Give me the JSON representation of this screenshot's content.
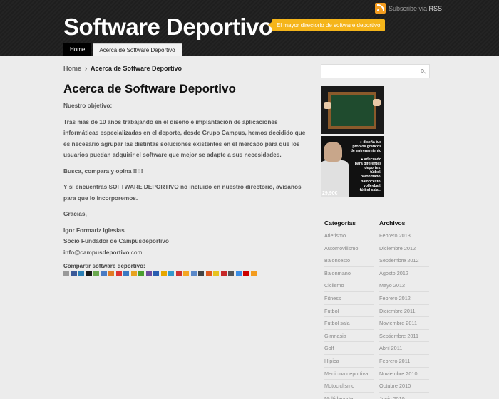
{
  "header": {
    "rss_prefix": "Subscribe via",
    "rss_label": "RSS",
    "site_title": "Software Deportivo",
    "tagline": "El mayor directorio de software deportivo",
    "nav": [
      "Home",
      "Acerca de Software Deportivo"
    ]
  },
  "breadcrumb": {
    "home": "Home",
    "separator": "›",
    "current": "Acerca de Software Deportivo"
  },
  "page": {
    "title": "Acerca de Software Deportivo",
    "objective": "Nuestro objetivo:",
    "p1": "Tras mas de 10 años trabajando en el diseño e implantación de aplicaciones informáticas especializadas en el deporte, desde  Grupo Campus, hemos decidido que es necesario agrupar las distintas soluciones existentes en el mercado para que los usuarios puedan adquirir el software que mejor se adapte a sus necesidades.",
    "p2": "Busca, compara y opina !!!!!",
    "p3": "Y si encuentras SOFTWARE DEPORTIVO no incluido en nuestro directorio, avísanos para que lo incorporemos.",
    "p4": "Gracias,",
    "sig1": "Igor Formariz Iglesias",
    "sig2": "Socio Fundador de Campusdeportivo",
    "email_bold": "info@campusdeportivo",
    "email_plain": ".com"
  },
  "share": {
    "label": "Compartir software deportivo:",
    "icon_colors": [
      "#999",
      "#3b5998",
      "#2a7fb5",
      "#1a1a1a",
      "#6aa84f",
      "#4a7bc4",
      "#e07b24",
      "#d33",
      "#3a78c2",
      "#e8a21f",
      "#4b9e2f",
      "#6d4c9e",
      "#2a5db0",
      "#e6a700",
      "#3399cc",
      "#cc3333",
      "#f5a623",
      "#5a88c9",
      "#444",
      "#e05a1f",
      "#e8c21f",
      "#c62828",
      "#555",
      "#3a8ee6",
      "#cc0000",
      "#f39c1f"
    ]
  },
  "sidebar": {
    "search_placeholder": "",
    "ad2_lines": [
      "● diseña tus",
      "propios gráficos",
      "de entrenamiento",
      "",
      "● adecuado",
      "para diferentes",
      "deportes:",
      "fútbol,",
      "balonmano,",
      "baloncesto,",
      "volleyball,",
      "fútbol sala..."
    ],
    "ad2_price": "29,90€",
    "categories_title": "Categorías",
    "archives_title": "Archivos",
    "categories": [
      "Atletismo",
      "Automovilismo",
      "Baloncesto",
      "Balonmano",
      "Ciclismo",
      "Fitness",
      "Futbol",
      "Futbol sala",
      "Gimnasia",
      "Golf",
      "Hípica",
      "Medicina deportiva",
      "Motociclismo",
      "Multideporte"
    ],
    "archives": [
      "Febrero 2013",
      "Diciembre 2012",
      "Septiembre 2012",
      "Agosto 2012",
      "Mayo 2012",
      "Febrero 2012",
      "Diciembre 2011",
      "Noviembre 2011",
      "Septiembre 2011",
      "Abril 2011",
      "Febrero 2011",
      "Noviembre 2010",
      "Octubre 2010",
      "Junio 2010"
    ]
  }
}
